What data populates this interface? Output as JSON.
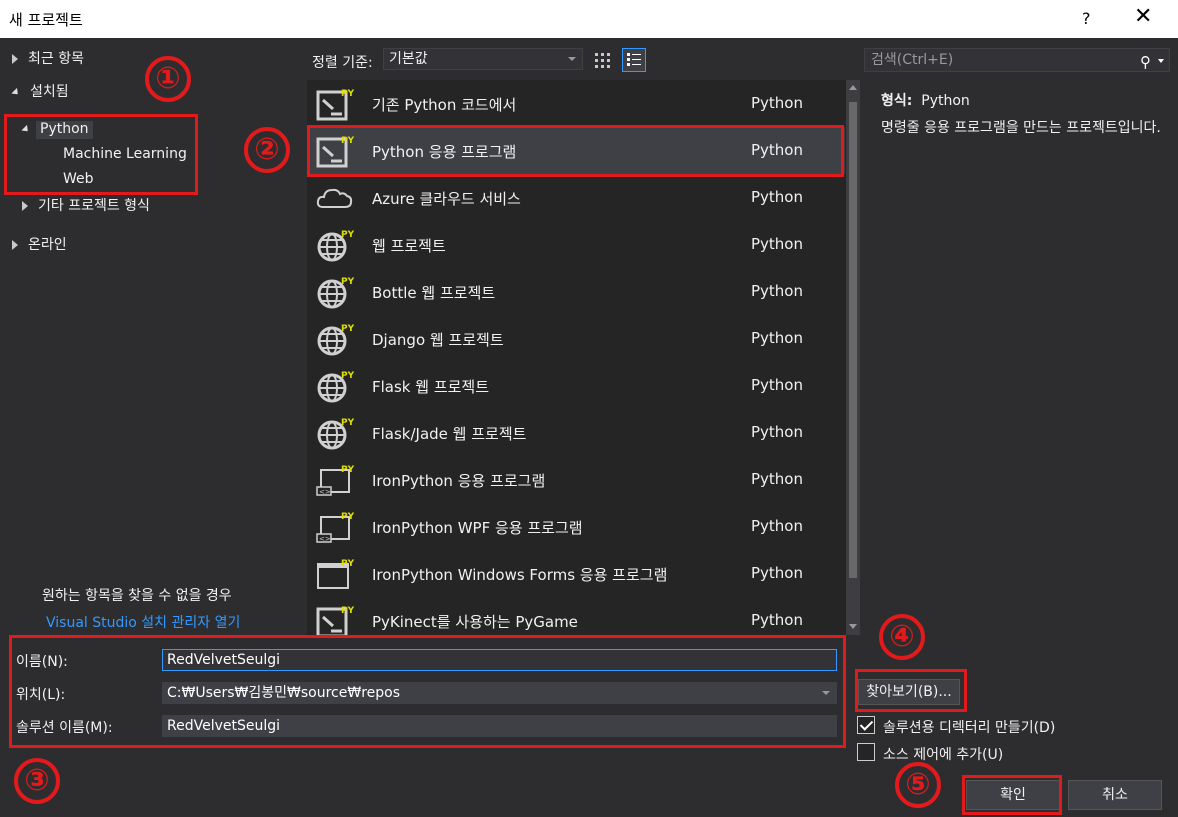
{
  "window": {
    "title": "새 프로젝트",
    "help_glyph": "?",
    "close_glyph": "✕"
  },
  "tree": {
    "recent": "최근 항목",
    "installed": "설치됨",
    "python": "Python",
    "machine_learning": "Machine Learning",
    "web": "Web",
    "other": "기타 프로젝트 형식",
    "online": "온라인"
  },
  "hint": {
    "text": "원하는 항목을 찾을 수 없을 경우",
    "link": "Visual Studio 설치 관리자 열기"
  },
  "sort": {
    "label": "정렬 기준:",
    "value": "기본값"
  },
  "search": {
    "placeholder": "검색(Ctrl+E)"
  },
  "templates": [
    {
      "name": "기존 Python 코드에서",
      "lang": "Python",
      "icon": "python-console-icon"
    },
    {
      "name": "Python 응용 프로그램",
      "lang": "Python",
      "icon": "python-console-icon",
      "selected": true
    },
    {
      "name": "Azure 클라우드 서비스",
      "lang": "Python",
      "icon": "cloud-icon"
    },
    {
      "name": "웹 프로젝트",
      "lang": "Python",
      "icon": "globe-icon"
    },
    {
      "name": "Bottle 웹 프로젝트",
      "lang": "Python",
      "icon": "globe-icon"
    },
    {
      "name": "Django 웹 프로젝트",
      "lang": "Python",
      "icon": "globe-icon"
    },
    {
      "name": "Flask 웹 프로젝트",
      "lang": "Python",
      "icon": "globe-icon"
    },
    {
      "name": "Flask/Jade 웹 프로젝트",
      "lang": "Python",
      "icon": "globe-icon"
    },
    {
      "name": "IronPython 응용 프로그램",
      "lang": "Python",
      "icon": "ironpython-window-icon"
    },
    {
      "name": "IronPython WPF 응용 프로그램",
      "lang": "Python",
      "icon": "ironpython-window-icon"
    },
    {
      "name": "IronPython Windows Forms 응용 프로그램",
      "lang": "Python",
      "icon": "window-icon"
    },
    {
      "name": "PyKinect를 사용하는 PyGame",
      "lang": "Python",
      "icon": "python-console-icon"
    }
  ],
  "detail": {
    "type_label": "형식:",
    "type_value": "Python",
    "description": "명령줄 응용 프로그램을 만드는 프로젝트입니다."
  },
  "form": {
    "name_label": "이름(N):",
    "name_value": "RedVelvetSeulgi",
    "location_label": "위치(L):",
    "location_value": "C:₩Users₩김봉민₩source₩repos",
    "solution_label": "솔루션 이름(M):",
    "solution_value": "RedVelvetSeulgi",
    "browse": "찾아보기(B)...",
    "create_dir": "솔루션용 디렉터리 만들기(D)",
    "source_control": "소스 제어에 추가(U)",
    "ok": "확인",
    "cancel": "취소"
  },
  "annotations": [
    "①",
    "②",
    "③",
    "④",
    "⑤"
  ],
  "colors": {
    "background": "#2d2d30",
    "list": "#252526",
    "accent": "#3399ff",
    "annotation": "#e31a1c"
  }
}
